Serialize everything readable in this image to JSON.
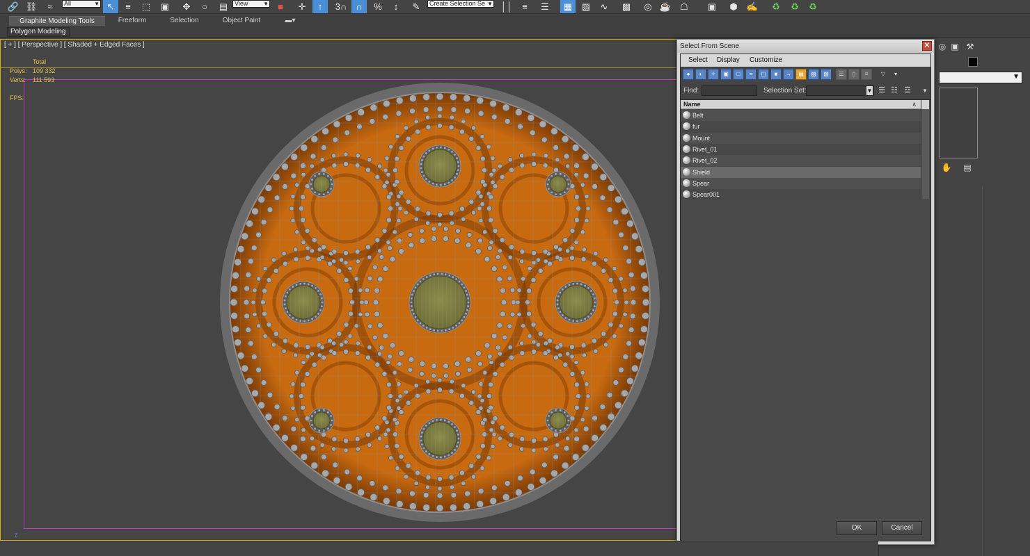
{
  "toolbar": {
    "selection_filter": "All",
    "ref_coord_system": "View",
    "named_selection_sets": "Create Selection Se"
  },
  "ribbon": {
    "tabs": [
      {
        "label": "Graphite Modeling Tools"
      },
      {
        "label": "Freeform"
      },
      {
        "label": "Selection"
      },
      {
        "label": "Object Paint"
      }
    ],
    "panel_label": "Polygon Modeling"
  },
  "viewport": {
    "label": "[ + ] [ Perspective ] [ Shaded + Edged Faces ]",
    "stats": {
      "header": "Total",
      "polys_label": "Polys:",
      "polys_value": "109 332",
      "verts_label": "Verts:",
      "verts_value": "111 593",
      "fps_label": "FPS:"
    },
    "axis_label": "z",
    "colors": {
      "shield_wood": "#c86a10",
      "shield_dark": "#7a3a05",
      "boss": "#6e6e3a",
      "rivet": "#a7a8aa",
      "wire": "#8e8e8e",
      "safe_frame": "#c43bc4",
      "active_border": "#d4b400"
    }
  },
  "dialog": {
    "title": "Select From Scene",
    "menu": [
      "Select",
      "Display",
      "Customize"
    ],
    "find_label": "Find:",
    "find_value": "",
    "selection_set_label": "Selection Set:",
    "column_name": "Name",
    "objects": [
      {
        "name": "Belt",
        "selected": false
      },
      {
        "name": "fur",
        "selected": false
      },
      {
        "name": "Mount",
        "selected": false
      },
      {
        "name": "Rivet_01",
        "selected": false
      },
      {
        "name": "Rivet_02",
        "selected": false
      },
      {
        "name": "Shield",
        "selected": true
      },
      {
        "name": "Spear",
        "selected": false
      },
      {
        "name": "Spear001",
        "selected": false
      }
    ],
    "ok_label": "OK",
    "cancel_label": "Cancel"
  }
}
